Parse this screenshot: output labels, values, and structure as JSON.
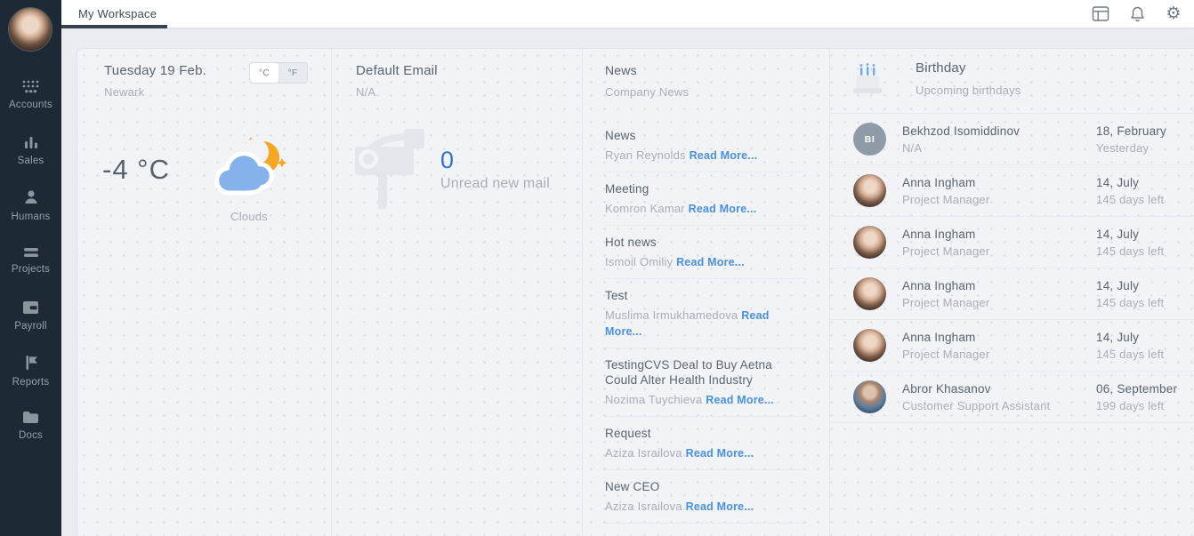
{
  "topbar": {
    "tab": "My Workspace",
    "icons": [
      "layout-icon",
      "notifications-icon",
      "settings-icon"
    ],
    "settings_glyph": "⚙"
  },
  "sidebar": {
    "items": [
      {
        "icon": "accounts-icon",
        "label": "Accounts"
      },
      {
        "icon": "sales-icon",
        "label": "Sales"
      },
      {
        "icon": "humans-icon",
        "label": "Humans"
      },
      {
        "icon": "projects-icon",
        "label": "Projects"
      },
      {
        "icon": "payroll-icon",
        "label": "Payroll"
      },
      {
        "icon": "reports-icon",
        "label": "Reports"
      },
      {
        "icon": "docs-icon",
        "label": "Docs"
      }
    ]
  },
  "weather": {
    "date": "Tuesday 19 Feb.",
    "city": "Newark",
    "unit_celsius": "°C",
    "unit_fahrenheit": "°F",
    "selected_unit": "°C",
    "temperature": "-4 °C",
    "condition": "Clouds",
    "icon": "clouds-moon-icon"
  },
  "email": {
    "title": "Default Email",
    "subtitle": "N/A",
    "icon": "mailbox-icon",
    "unread_count": "0",
    "unread_label": "Unread new mail"
  },
  "news": {
    "title": "News",
    "subtitle": "Company News",
    "read_more": "Read More...",
    "items": [
      {
        "title": "News",
        "author": "Ryan Reynolds"
      },
      {
        "title": "Meeting",
        "author": "Komron Kamar"
      },
      {
        "title": "Hot news",
        "author": "Ismoil Omiliy"
      },
      {
        "title": "Test",
        "author": "Muslima Irmukhamedova"
      },
      {
        "title": "TestingCVS Deal to Buy Aetna Could Alter Health Industry",
        "author": "Nozima Tuychieva"
      },
      {
        "title": "Request",
        "author": "Aziza Israilova"
      },
      {
        "title": "New CEO",
        "author": "Aziza Israilova"
      }
    ]
  },
  "birthday": {
    "title": "Birthday",
    "subtitle": "Upcoming birthdays",
    "icon": "birthday-cake-icon",
    "rows": [
      {
        "avatar": "initials",
        "initials": "BI",
        "name": "Bekhzod Isomiddinov",
        "role": "N/A",
        "date": "18, February",
        "remaining": "Yesterday"
      },
      {
        "avatar": "photo-woman",
        "name": "Anna Ingham",
        "role": "Project Manager",
        "date": "14, July",
        "remaining": "145 days left"
      },
      {
        "avatar": "photo-woman",
        "name": "Anna Ingham",
        "role": "Project Manager",
        "date": "14, July",
        "remaining": "145 days left"
      },
      {
        "avatar": "photo-woman",
        "name": "Anna Ingham",
        "role": "Project Manager",
        "date": "14, July",
        "remaining": "145 days left"
      },
      {
        "avatar": "photo-woman",
        "name": "Anna Ingham",
        "role": "Project Manager",
        "date": "14, July",
        "remaining": "145 days left"
      },
      {
        "avatar": "photo-man",
        "name": "Abror Khasanov",
        "role": "Customer Support Assistant",
        "date": "06, September",
        "remaining": "199 days left"
      }
    ]
  },
  "colors": {
    "sidebar_bg": "#1d2935",
    "accent_link_blue": "#4a90e2",
    "count_blue": "#3076c9",
    "moon_orange": "#f5a623",
    "cloud_blue": "#85b2ea"
  }
}
